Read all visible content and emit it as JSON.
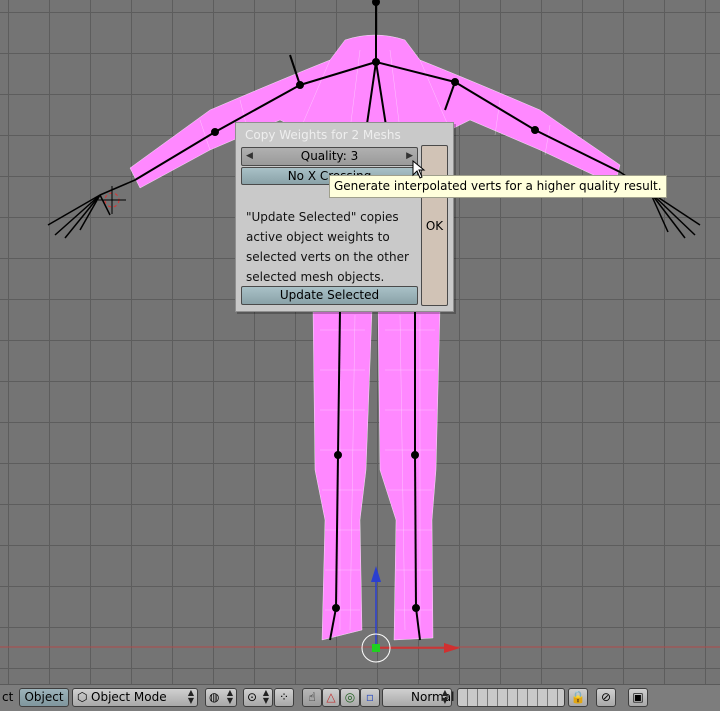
{
  "popup": {
    "title": "Copy Weights for 2 Meshs",
    "quality_label": "Quality: 3",
    "no_x_crossing_label": "No X Crossing",
    "ok_label": "OK",
    "help_lines": [
      "\"Update Selected\" copies",
      "active object weights to",
      "selected verts on the other",
      "selected mesh objects."
    ],
    "update_selected_label": "Update Selected"
  },
  "tooltip": {
    "text": "Generate interpolated verts for a higher quality result."
  },
  "header": {
    "menu_fragment": "ct",
    "object_menu": "Object",
    "mode_select": "Object Mode",
    "shading_select": "Normal"
  },
  "colors": {
    "mesh": "#ff88ff",
    "accent_button": "#9ab4bb",
    "ok_button": "#d1c3b6",
    "tooltip_bg": "#ffffdc"
  }
}
